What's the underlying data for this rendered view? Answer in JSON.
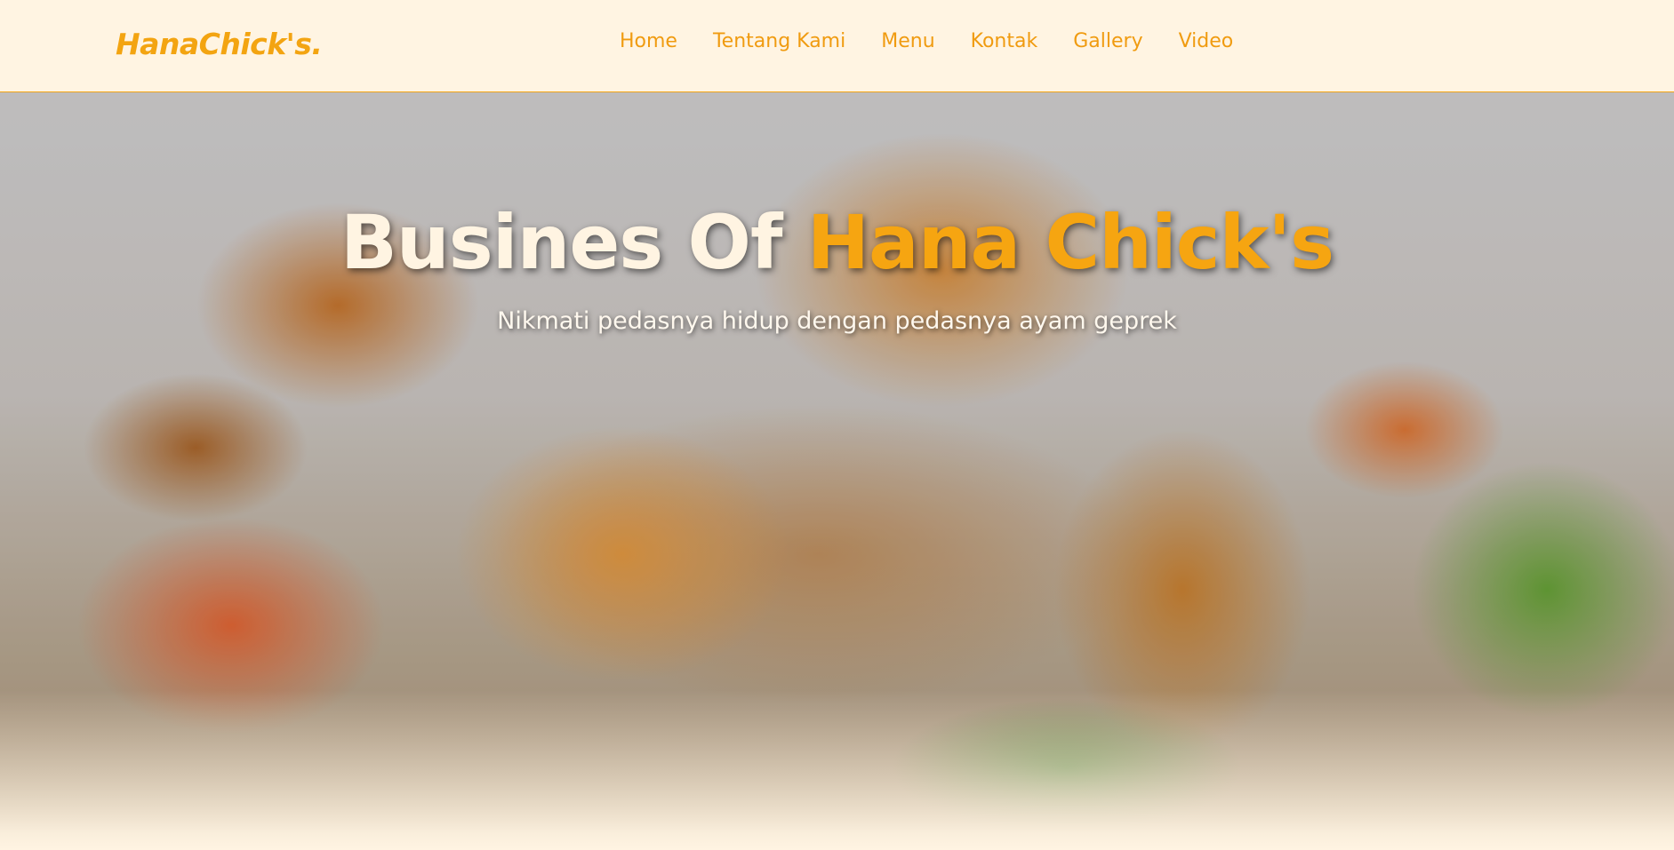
{
  "brand": {
    "name": "HanaChick's."
  },
  "nav": {
    "items": [
      {
        "label": "Home"
      },
      {
        "label": "Tentang Kami"
      },
      {
        "label": "Menu"
      },
      {
        "label": "Kontak"
      },
      {
        "label": "Gallery"
      },
      {
        "label": "Video"
      }
    ]
  },
  "hero": {
    "title_part1": "Busines Of",
    "title_accent": "Hana Chick's",
    "subtitle": "Nikmati pedasnya hidup dengan pedasnya ayam geprek"
  },
  "colors": {
    "accent": "#f6a511",
    "background": "#fff4e2"
  }
}
